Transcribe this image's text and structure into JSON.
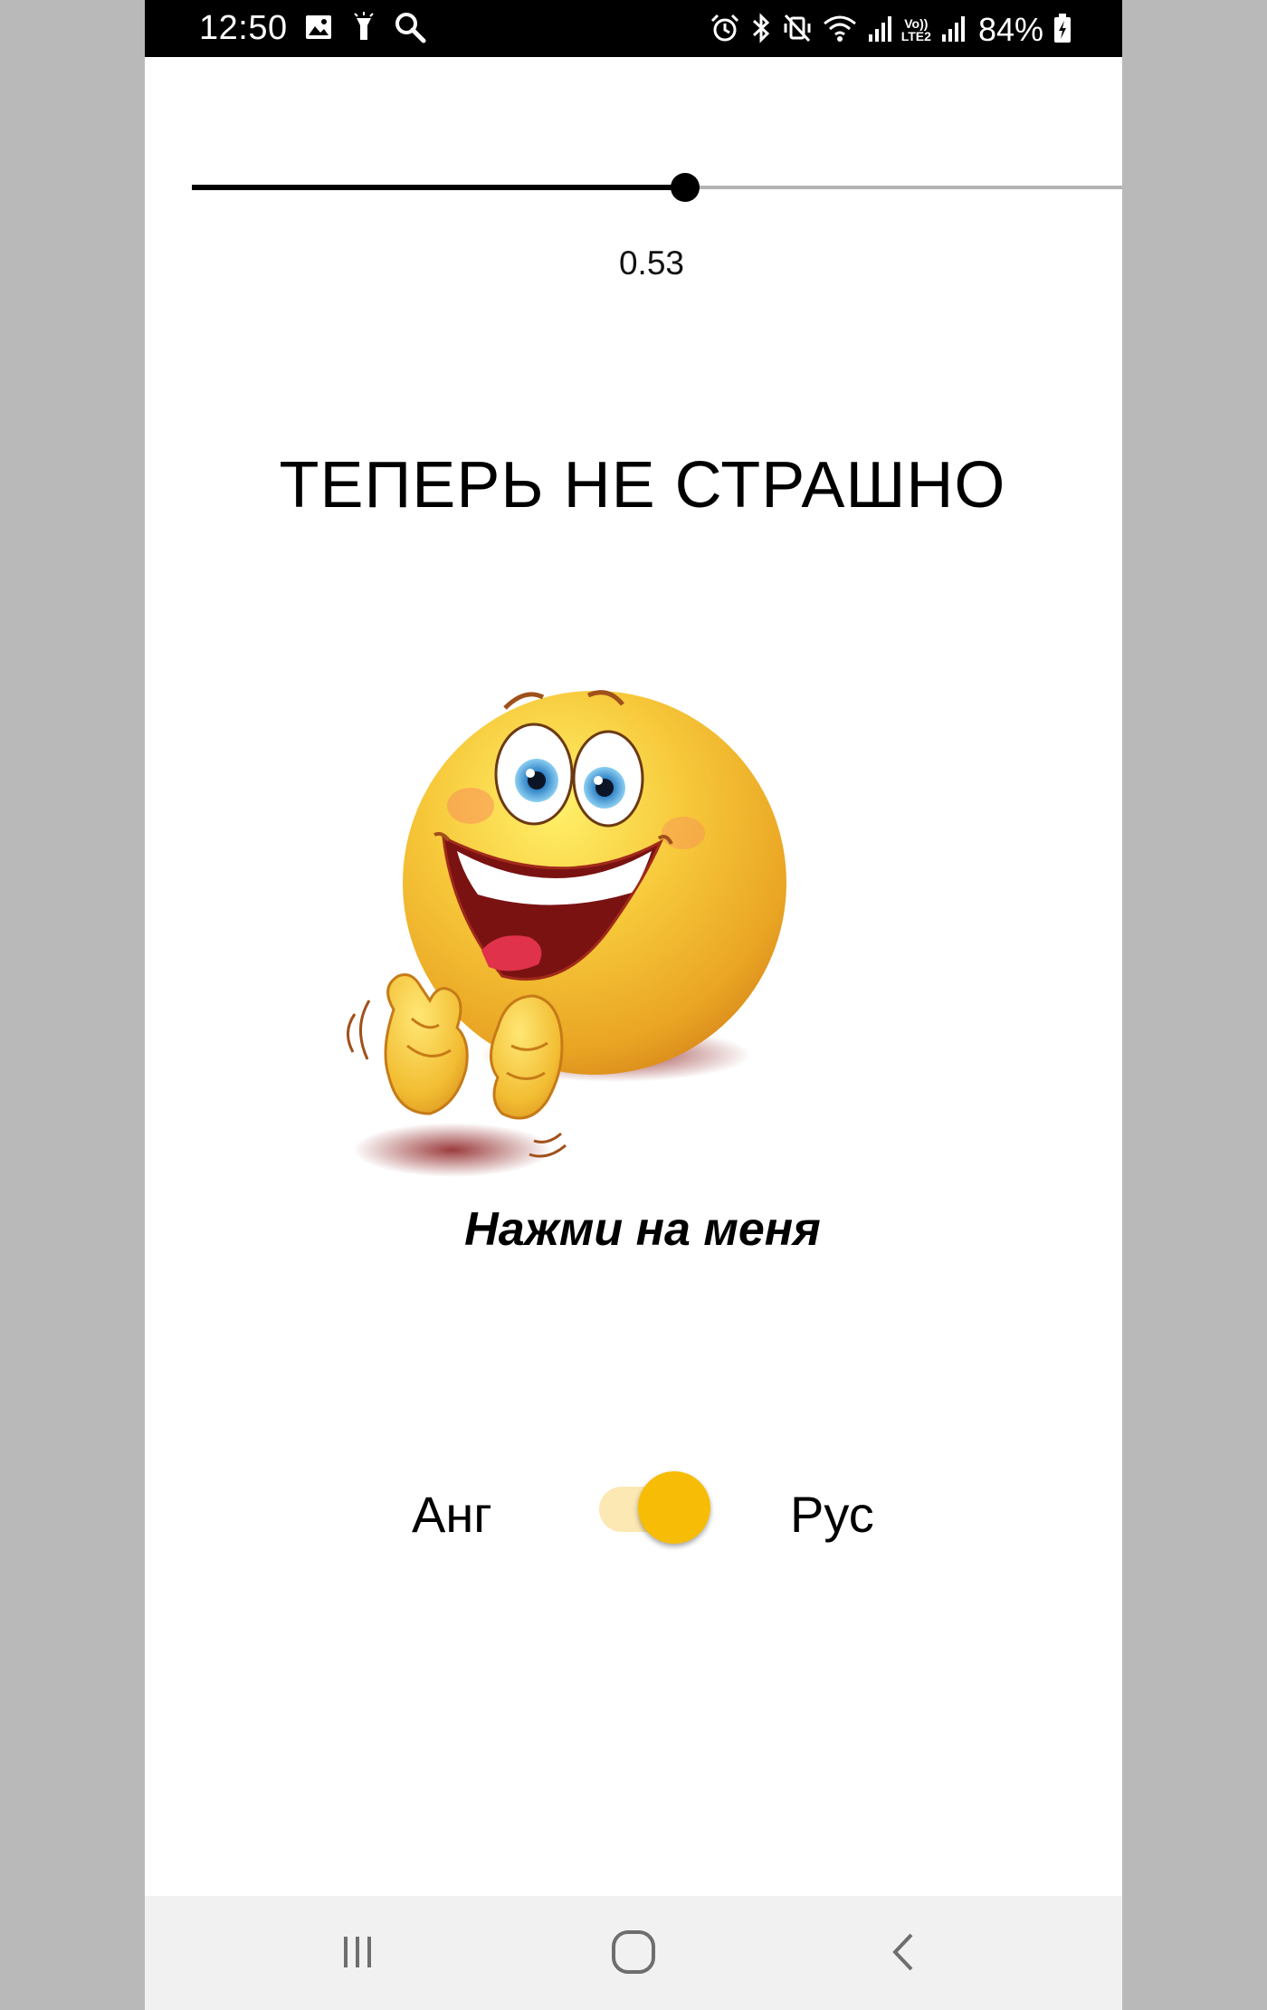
{
  "status_bar": {
    "time": "12:50",
    "battery": "84%",
    "left_icons": [
      "gallery-icon",
      "flashlight-icon",
      "search-icon"
    ],
    "right_icons": [
      "alarm-icon",
      "bluetooth-icon",
      "vibrate-mute-icon",
      "wifi-icon",
      "signal-icon",
      "volte-icon",
      "signal-icon",
      "battery-charging-icon"
    ],
    "volte_label_top": "Vo))",
    "volte_label_bottom": "LTE2"
  },
  "slider": {
    "value": 0.53,
    "value_label": "0.53"
  },
  "headline": "ТЕПЕРЬ НЕ СТРАШНО",
  "emoji": {
    "icon": "clapping-smiley-icon"
  },
  "caption": "Нажми на меня",
  "language_switch": {
    "left_label": "Анг",
    "right_label": "Рус",
    "checked": true,
    "accent_color": "#f7bd06",
    "track_color": "#fbe8b3"
  },
  "nav_bar": {
    "buttons": [
      "recent-apps-icon",
      "home-icon",
      "back-icon"
    ]
  }
}
